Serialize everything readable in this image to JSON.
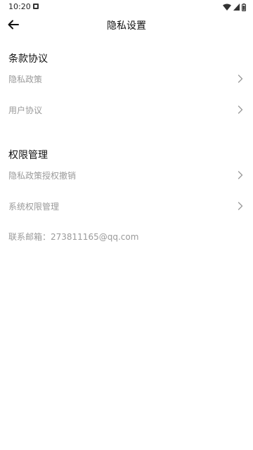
{
  "status_bar": {
    "time": "10:20",
    "notification_icon": "notification-app-icon",
    "wifi_icon": "wifi-icon",
    "signal_icon": "cell-signal-icon",
    "battery_icon": "battery-icon"
  },
  "header": {
    "back_icon": "arrow-left-icon",
    "title": "隐私设置"
  },
  "sections": {
    "terms": {
      "title": "条款协议",
      "items": [
        {
          "label": "隐私政策",
          "icon": "chevron-right-icon"
        },
        {
          "label": "用户协议",
          "icon": "chevron-right-icon"
        }
      ]
    },
    "permissions": {
      "title": "权限管理",
      "items": [
        {
          "label": "隐私政策授权撤销",
          "icon": "chevron-right-icon"
        },
        {
          "label": "系统权限管理",
          "icon": "chevron-right-icon"
        }
      ]
    }
  },
  "contact": {
    "text": "联系邮箱：273811165@qq.com"
  },
  "colors": {
    "background": "#ffffff",
    "primary_text": "#111111",
    "secondary_text": "#9a9a9a",
    "chevron": "#9a9a9a"
  }
}
